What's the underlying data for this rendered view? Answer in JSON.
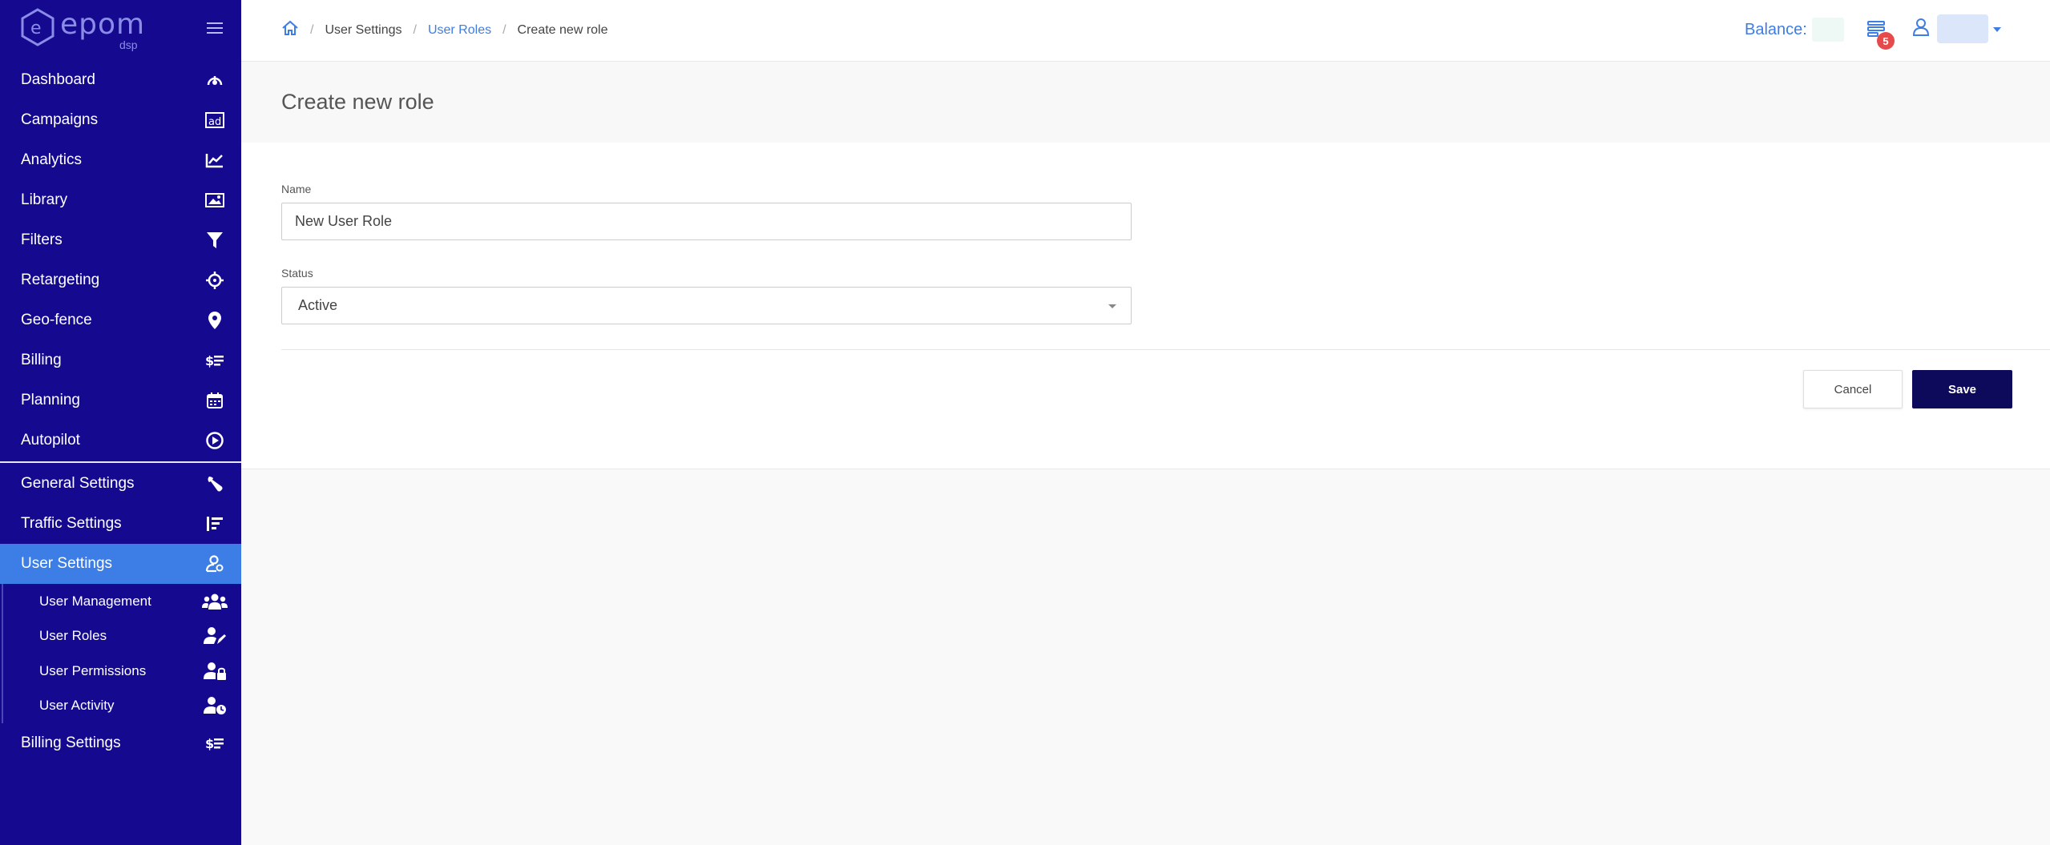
{
  "brand": {
    "name": "epom",
    "sub": "dsp"
  },
  "sidebar": {
    "items": [
      {
        "label": "Dashboard",
        "icon": "dashboard-icon"
      },
      {
        "label": "Campaigns",
        "icon": "ad-icon"
      },
      {
        "label": "Analytics",
        "icon": "chart-line-icon"
      },
      {
        "label": "Library",
        "icon": "image-icon"
      },
      {
        "label": "Filters",
        "icon": "filter-icon"
      },
      {
        "label": "Retargeting",
        "icon": "crosshair-icon"
      },
      {
        "label": "Geo-fence",
        "icon": "map-pin-icon"
      },
      {
        "label": "Billing",
        "icon": "dollar-list-icon"
      },
      {
        "label": "Planning",
        "icon": "calendar-icon"
      },
      {
        "label": "Autopilot",
        "icon": "play-circle-icon"
      }
    ],
    "settings": [
      {
        "label": "General Settings",
        "icon": "wrench-icon"
      },
      {
        "label": "Traffic Settings",
        "icon": "list-sort-icon"
      },
      {
        "label": "User Settings",
        "icon": "user-gear-icon",
        "active": true
      }
    ],
    "sub_items": [
      {
        "label": "User Management",
        "icon": "users-icon"
      },
      {
        "label": "User Roles",
        "icon": "user-edit-icon"
      },
      {
        "label": "User Permissions",
        "icon": "user-lock-icon"
      },
      {
        "label": "User Activity",
        "icon": "user-clock-icon"
      }
    ],
    "billing_settings": {
      "label": "Billing Settings",
      "icon": "dollar-list-icon"
    }
  },
  "breadcrumb": {
    "home_icon": "home-icon",
    "items": [
      "User Settings",
      "User Roles",
      "Create new role"
    ]
  },
  "header": {
    "balance_label": "Balance:",
    "notification_count": "5"
  },
  "page": {
    "title": "Create new role",
    "name_label": "Name",
    "name_value": "New User Role",
    "status_label": "Status",
    "status_value": "Active",
    "cancel_label": "Cancel",
    "save_label": "Save"
  },
  "colors": {
    "sidebar_bg": "#150a8f",
    "active_item": "#3d7de6",
    "accent": "#3d7de6",
    "save_button": "#0d0a5c",
    "badge": "#e64a4a"
  }
}
